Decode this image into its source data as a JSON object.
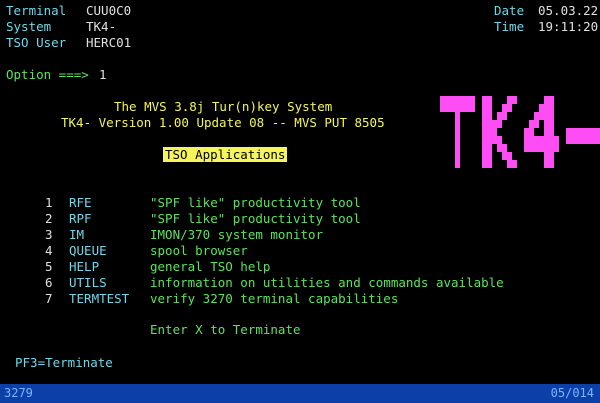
{
  "header": {
    "terminal_label": "Terminal",
    "terminal_value": "CUU0C0",
    "system_label": "System",
    "system_value": "TK4-",
    "tso_user_label": "TSO User",
    "tso_user_value": "HERC01",
    "date_label": "Date",
    "date_value": "05.03.22",
    "time_label": "Time",
    "time_value": "19:11:20"
  },
  "option": {
    "prompt": "Option ===>",
    "value": "1"
  },
  "banner": {
    "line1": "The MVS 3.8j Tur(n)key System",
    "line2": "TK4- Version 1.00 Update 08 -- MVS PUT 8505",
    "section_title": "TSO Applications"
  },
  "logo_text": "TK4-",
  "menu": [
    {
      "num": "1",
      "name": "RFE",
      "desc": "\"SPF like\" productivity tool"
    },
    {
      "num": "2",
      "name": "RPF",
      "desc": "\"SPF like\" productivity tool"
    },
    {
      "num": "3",
      "name": "IM",
      "desc": "IMON/370 system monitor"
    },
    {
      "num": "4",
      "name": "QUEUE",
      "desc": "spool browser"
    },
    {
      "num": "5",
      "name": "HELP",
      "desc": "general TSO help"
    },
    {
      "num": "6",
      "name": "UTILS",
      "desc": "information on utilities and commands available"
    },
    {
      "num": "7",
      "name": "TERMTEST",
      "desc": "verify 3270 terminal capabilities"
    }
  ],
  "exit_text": "Enter X to Terminate",
  "pf_keys": "PF3=Terminate",
  "status_bar": {
    "model": "3279",
    "cursor": "05/014"
  },
  "colors": {
    "background": "#000000",
    "label_cyan": "#6fd8e8",
    "text_green": "#5ce35c",
    "text_yellow": "#f5f55a",
    "logo_magenta": "#ff4df5",
    "status_blue": "#0d3fa8"
  }
}
